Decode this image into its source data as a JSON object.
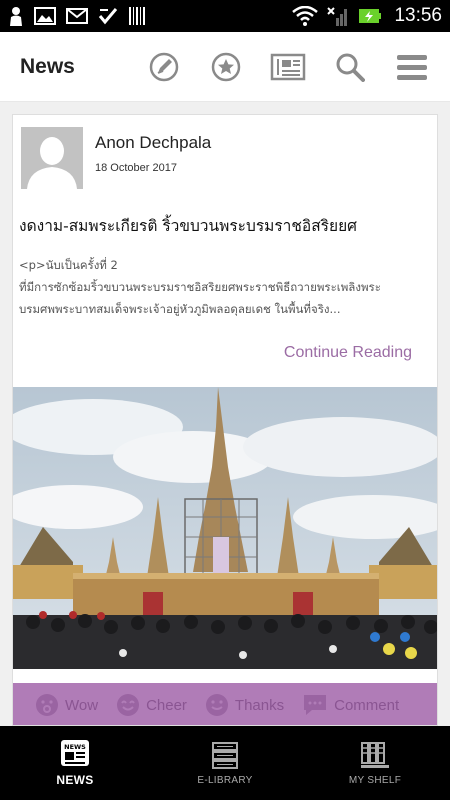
{
  "status_bar": {
    "time": "13:56",
    "icons": [
      "person-icon",
      "gallery-icon",
      "gmail-icon",
      "check-icon",
      "barcode-icon",
      "wifi-icon",
      "signal-icon",
      "battery-charging-icon"
    ]
  },
  "app_bar": {
    "title": "News",
    "actions": [
      "compose-icon",
      "star-icon",
      "newspaper-icon",
      "search-icon",
      "menu-icon"
    ]
  },
  "post": {
    "author": "Anon Dechpala",
    "date": "18 October 2017",
    "title": "งดงาม-สมพระเกียรติ ริ้วขบวนพระบรมราชอิสริยยศ",
    "excerpt_line1": "<p>นับเป็นครั้งที่ 2",
    "excerpt_line2": "ที่มีการซักซ้อมริ้วขบวนพระบรมราชอิสริยยศพระราชพิธีถวายพระเพลิงพระ",
    "excerpt_line3": "บรมศพพระบาทสมเด็จพระเจ้าอยู่หัวภูมิพลอดุลยเดช ในพื้นที่จริง...",
    "continue_label": "Continue Reading",
    "reactions": [
      {
        "label": "Wow",
        "icon": "wow-face-icon"
      },
      {
        "label": "Cheer",
        "icon": "cheer-face-icon"
      },
      {
        "label": "Thanks",
        "icon": "smile-face-icon"
      },
      {
        "label": "Comment",
        "icon": "comment-icon"
      }
    ]
  },
  "bottom_nav": [
    {
      "label": "NEWS",
      "icon": "news-icon",
      "active": true
    },
    {
      "label": "E-LIBRARY",
      "icon": "books-icon",
      "active": false
    },
    {
      "label": "MY SHELF",
      "icon": "shelf-icon",
      "active": false
    }
  ],
  "colors": {
    "accent": "#9b6ca4",
    "reaction_bar": "#b07cb7",
    "reaction_text": "#8a5592",
    "status_bar": "#000000",
    "battery": "#6ad12b"
  }
}
